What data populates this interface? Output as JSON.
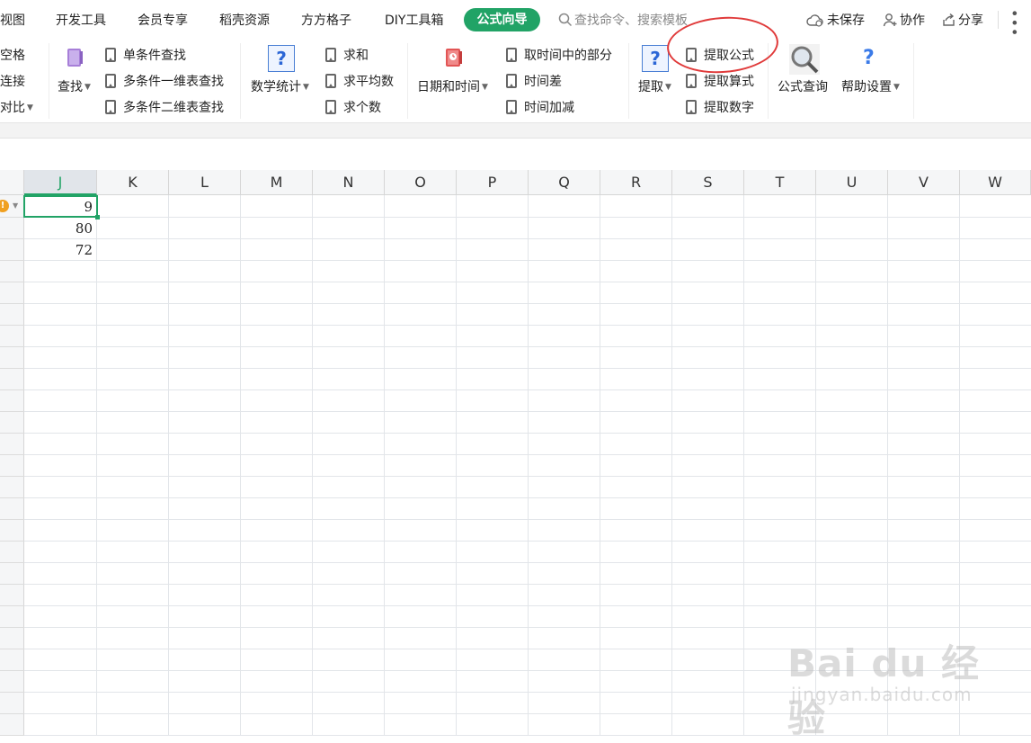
{
  "menu": {
    "items": [
      "视图",
      "开发工具",
      "会员专享",
      "稻壳资源",
      "方方格子",
      "DIY工具箱"
    ],
    "active": "公式向导",
    "search_placeholder": "查找命令、搜索模板",
    "unsaved": "未保存",
    "collab": "协作",
    "share": "分享"
  },
  "ribbon": {
    "partial_left": [
      "空格",
      "连接",
      "对比"
    ],
    "lookup": "查找",
    "lookup_items": [
      "单条件查找",
      "多条件一维表查找",
      "多条件二维表查找"
    ],
    "math_stats": "数学统计",
    "math_items": [
      "求和",
      "求平均数",
      "求个数"
    ],
    "datetime": "日期和时间",
    "datetime_items": [
      "取时间中的部分",
      "时间差",
      "时间加减"
    ],
    "extract": "提取",
    "extract_items": [
      "提取公式",
      "提取算式",
      "提取数字"
    ],
    "formula_query": "公式查询",
    "help_settings": "帮助设置"
  },
  "sheet": {
    "columns": [
      "J",
      "K",
      "L",
      "M",
      "N",
      "O",
      "P",
      "Q",
      "R",
      "S",
      "T",
      "U",
      "V",
      "W"
    ],
    "selected_column": "J",
    "column_j_values": [
      "9",
      "80",
      "72"
    ]
  },
  "colors": {
    "accent": "#21a366",
    "highlight_circle": "#e03a3a"
  },
  "watermark": {
    "main": "Bai du 经验",
    "sub": "jingyan.baidu.com"
  }
}
